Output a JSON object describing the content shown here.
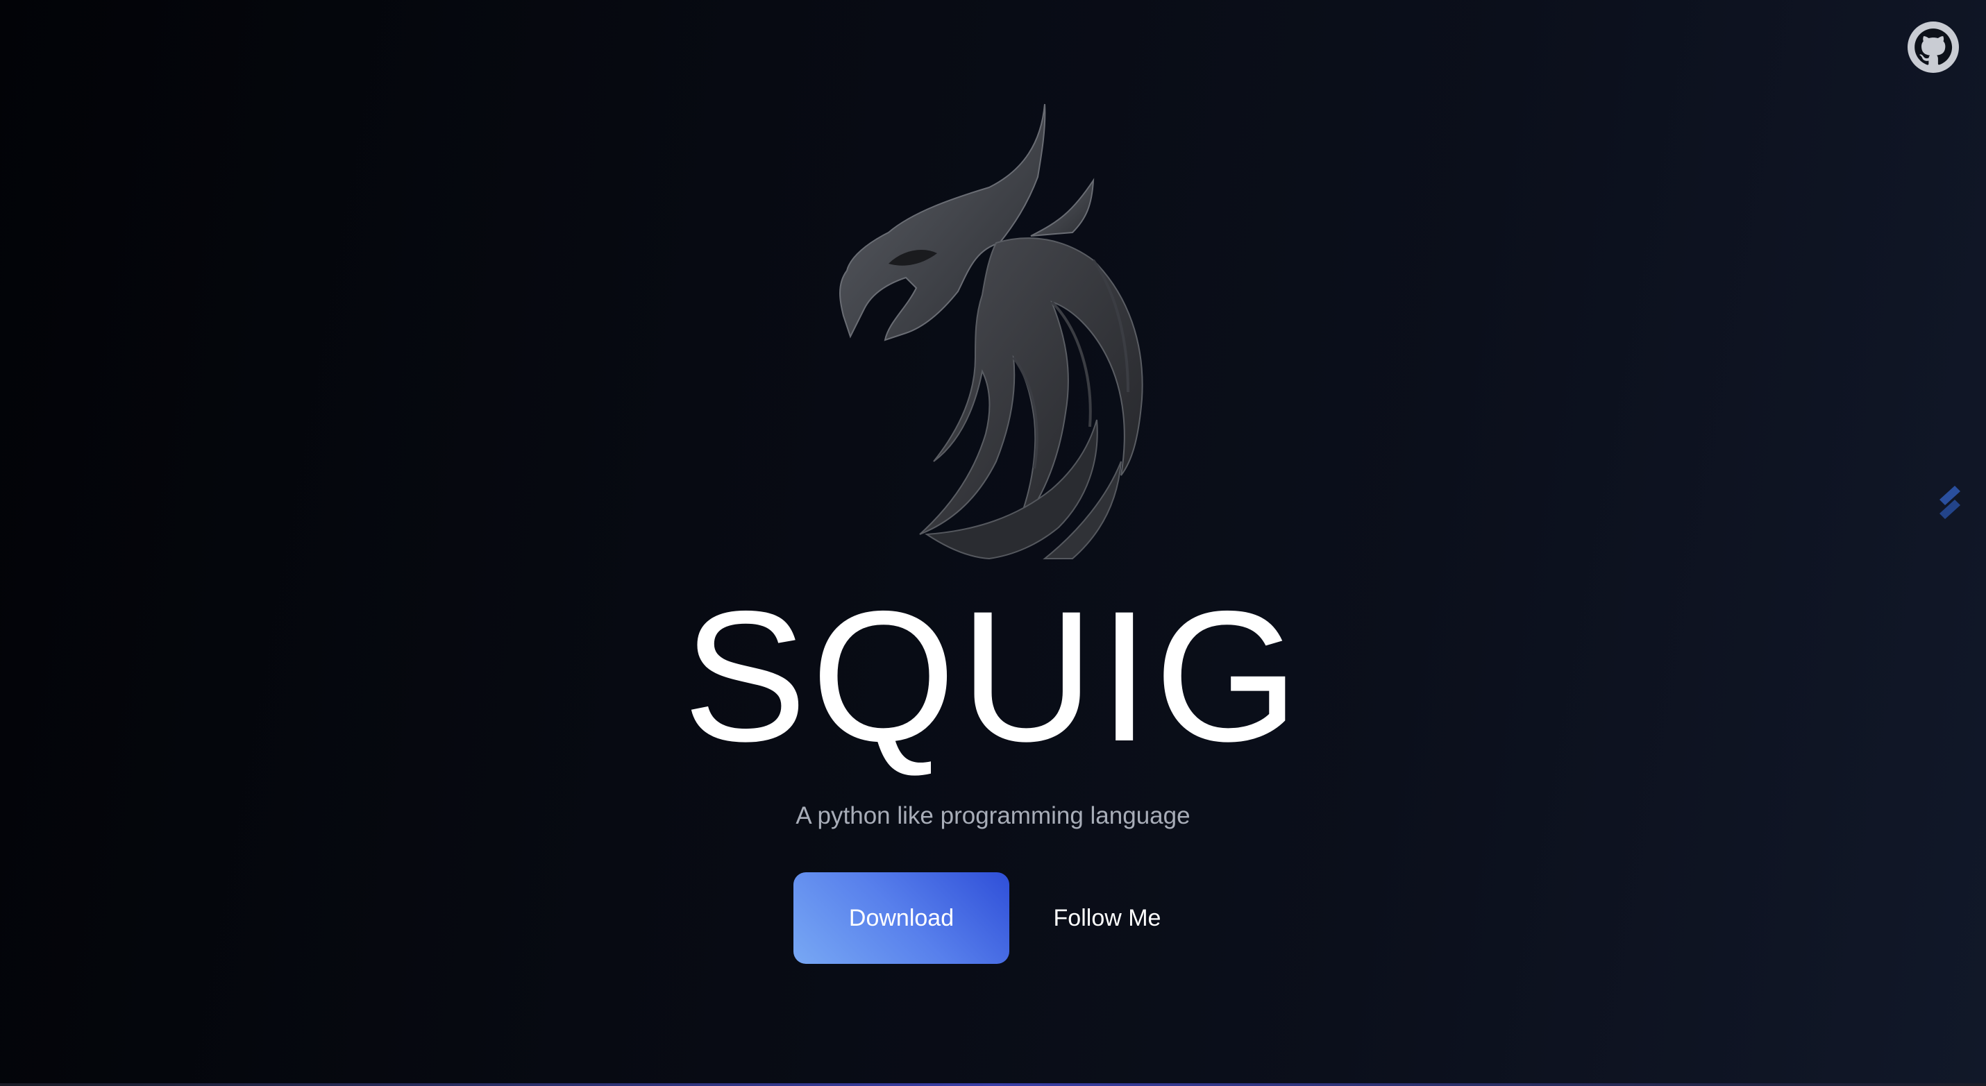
{
  "header": {
    "github_icon": "github-icon"
  },
  "side_widget": {
    "icon": "stripe-icon",
    "color": "#2a4f9e"
  },
  "hero": {
    "logo_icon": "dragon-logo-icon",
    "title": "SQUIG",
    "subtitle": "A python like programming language"
  },
  "actions": {
    "download_label": "Download",
    "follow_label": "Follow Me"
  },
  "colors": {
    "accent_start": "#78a8f4",
    "accent_end": "#2f4fd8",
    "subtitle": "#a8adb8"
  }
}
